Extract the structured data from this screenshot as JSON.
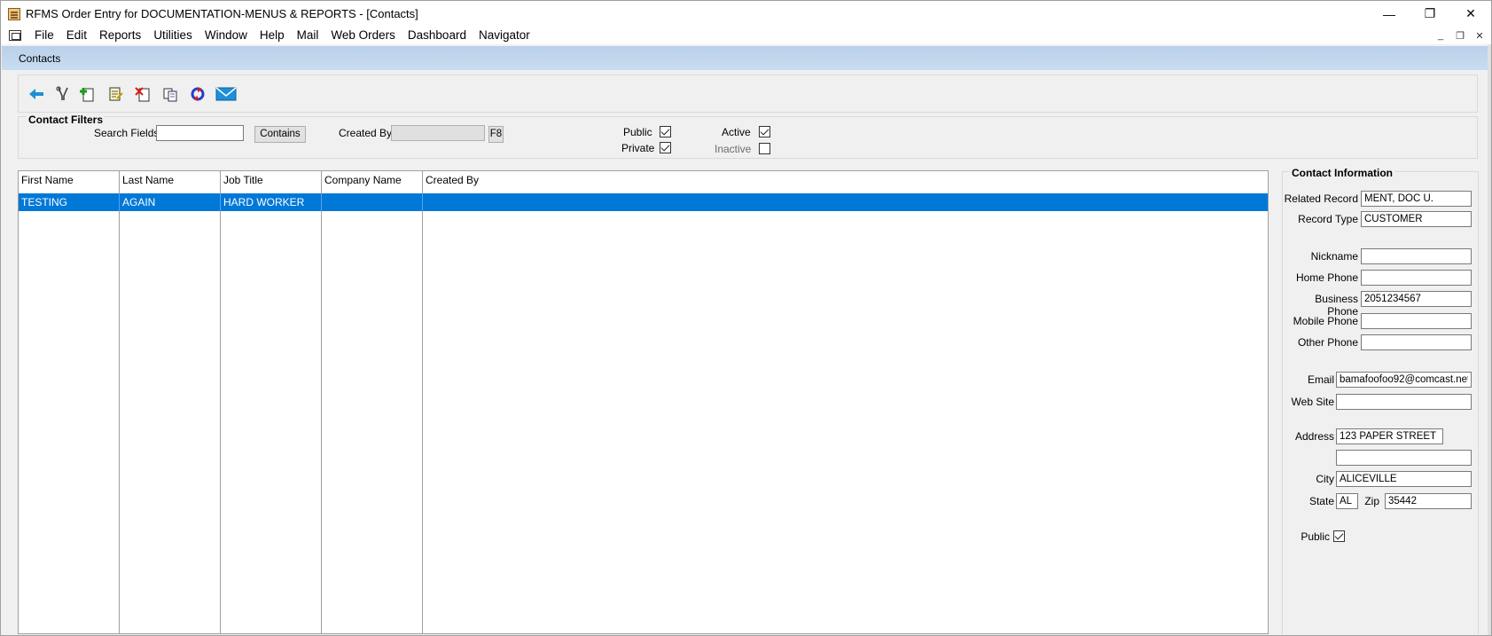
{
  "window": {
    "title": "RFMS Order Entry for DOCUMENTATION-MENUS & REPORTS - [Contacts]",
    "controls": {
      "minimize": "—",
      "restore": "❐",
      "close": "✕"
    }
  },
  "menubar": {
    "items": [
      "File",
      "Edit",
      "Reports",
      "Utilities",
      "Window",
      "Help",
      "Mail",
      "Web Orders",
      "Dashboard",
      "Navigator"
    ],
    "mdi_controls": {
      "minimize": "_",
      "restore": "❐",
      "close": "✕"
    }
  },
  "form": {
    "caption": "Contacts"
  },
  "toolbar": {
    "icons": [
      "back-arrow-icon",
      "tools-icon",
      "add-record-icon",
      "edit-record-icon",
      "delete-record-icon",
      "copy-icon",
      "refresh-icon",
      "email-icon"
    ]
  },
  "filters": {
    "title": "Contact Filters",
    "search_fields_label": "Search Fields",
    "search_value": "",
    "contains_button": "Contains",
    "created_by_label": "Created By",
    "created_by_value": "",
    "f8_button": "F8",
    "public_label": "Public",
    "public_checked": true,
    "private_label": "Private",
    "private_checked": true,
    "active_label": "Active",
    "active_checked": true,
    "inactive_label": "Inactive",
    "inactive_checked": false
  },
  "grid": {
    "columns": [
      "First Name",
      "Last Name",
      "Job Title",
      "Company Name",
      "Created By"
    ],
    "rows": [
      [
        "TESTING",
        "AGAIN",
        "HARD WORKER",
        "",
        ""
      ]
    ],
    "selected_color": "#0078d7"
  },
  "contact_info": {
    "title": "Contact Information",
    "related_record_label": "Related Record",
    "related_record": "MENT, DOC U.",
    "record_type_label": "Record Type",
    "record_type": "CUSTOMER",
    "nickname_label": "Nickname",
    "nickname": "",
    "home_phone_label": "Home Phone",
    "home_phone": "",
    "business_phone_label": "Business Phone",
    "business_phone": "2051234567",
    "mobile_phone_label": "Mobile Phone",
    "mobile_phone": "",
    "other_phone_label": "Other Phone",
    "other_phone": "",
    "email_label": "Email",
    "email": "bamafoofoo92@comcast.net",
    "website_label": "Web Site",
    "website": "",
    "address_label": "Address",
    "address1": "123 PAPER STREET",
    "address2": "",
    "city_label": "City",
    "city": "ALICEVILLE",
    "state_label": "State",
    "state": "AL",
    "zip_label": "Zip",
    "zip": "35442",
    "public_label": "Public",
    "public_checked": true
  }
}
